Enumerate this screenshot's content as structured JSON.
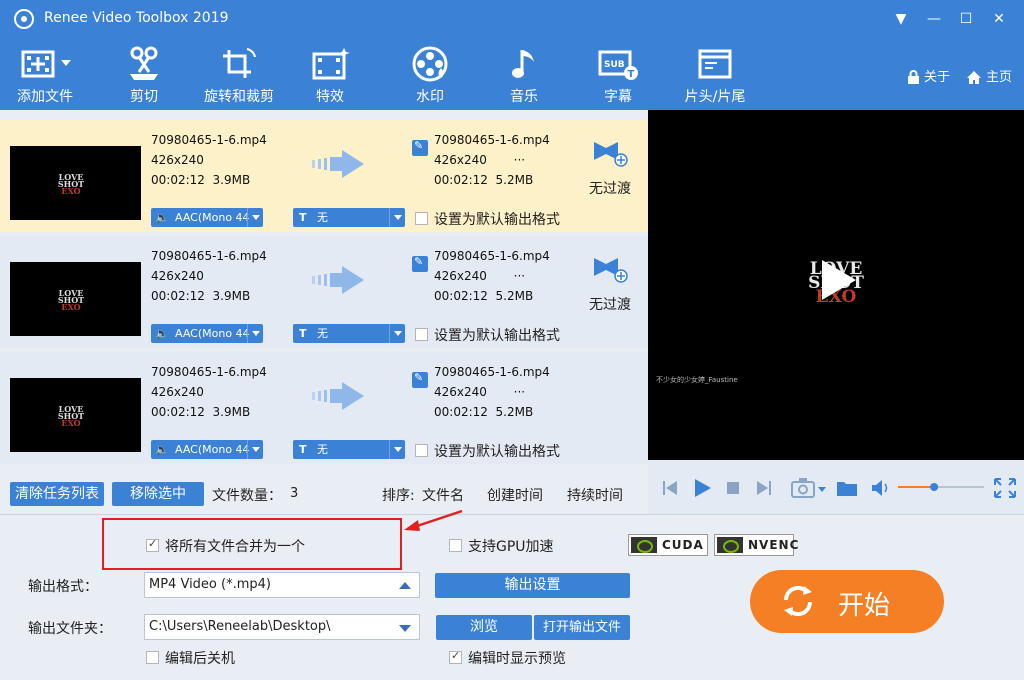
{
  "window": {
    "title": "Renee Video Toolbox 2019",
    "controls": [
      "▼",
      "—",
      "☐",
      "✕"
    ]
  },
  "toolbar": {
    "tools": [
      {
        "label": "添加文件",
        "icon": "add-file-icon"
      },
      {
        "label": "剪切",
        "icon": "scissors-icon"
      },
      {
        "label": "旋转和裁剪",
        "icon": "crop-rotate-icon"
      },
      {
        "label": "特效",
        "icon": "effects-icon"
      },
      {
        "label": "水印",
        "icon": "watermark-icon"
      },
      {
        "label": "音乐",
        "icon": "music-note-icon"
      },
      {
        "label": "字幕",
        "icon": "subtitle-icon"
      },
      {
        "label": "片头/片尾",
        "icon": "intro-outro-icon"
      }
    ],
    "about": "关于",
    "home": "主页"
  },
  "files": [
    {
      "name": "70980465-1-6.mp4",
      "resolution": "426x240",
      "duration": "00:02:12",
      "size": "3.9MB",
      "output_name": "70980465-1-6.mp4",
      "output_resolution": "426x240",
      "output_extra": "···",
      "output_duration": "00:02:12",
      "output_size": "5.2MB",
      "audio": "AAC(Mono 44",
      "subtitle_prefix": "T",
      "subtitle": "无",
      "default_label": "设置为默认输出格式",
      "transition": "无过渡",
      "selected": true
    },
    {
      "name": "70980465-1-6.mp4",
      "resolution": "426x240",
      "duration": "00:02:12",
      "size": "3.9MB",
      "output_name": "70980465-1-6.mp4",
      "output_resolution": "426x240",
      "output_extra": "···",
      "output_duration": "00:02:12",
      "output_size": "5.2MB",
      "audio": "AAC(Mono 44",
      "subtitle_prefix": "T",
      "subtitle": "无",
      "default_label": "设置为默认输出格式",
      "transition": "无过渡",
      "selected": false
    },
    {
      "name": "70980465-1-6.mp4",
      "resolution": "426x240",
      "duration": "00:02:12",
      "size": "3.9MB",
      "output_name": "70980465-1-6.mp4",
      "output_resolution": "426x240",
      "output_extra": "···",
      "output_duration": "00:02:12",
      "output_size": "5.2MB",
      "audio": "AAC(Mono 44",
      "subtitle_prefix": "T",
      "subtitle": "无",
      "default_label": "设置为默认输出格式",
      "transition": "",
      "selected": false
    }
  ],
  "thumb_logo": {
    "line1": "LOVE",
    "line2": "SHOT",
    "line3": "EXO",
    "caption": "不少女的少女婷_Faustine"
  },
  "list_footer": {
    "clear": "清除任务列表",
    "remove": "移除选中",
    "count_label": "文件数量：",
    "count": "3",
    "sort_label": "排序:",
    "sort_name": "文件名",
    "sort_created": "创建时间",
    "sort_duration": "持续时间"
  },
  "preview": {
    "logo1": "LOVE",
    "logo2": "SHOT",
    "logo3": "EXO",
    "caption": "不少女的少女婷_Faustine",
    "volume": 0.42
  },
  "bottom": {
    "merge_label": "将所有文件合并为一个",
    "merge_checked": true,
    "gpu_label": "支持GPU加速",
    "gpu_checked": false,
    "cuda": "CUDA",
    "nvenc": "NVENC",
    "format_label": "输出格式：",
    "format_value": "MP4 Video (*.mp4)",
    "output_settings": "输出设置",
    "folder_label": "输出文件夹：",
    "folder_value": "C:\\Users\\Reneelab\\Desktop\\",
    "browse": "浏览",
    "open_output": "打开输出文件",
    "shutdown_label": "编辑后关机",
    "shutdown_checked": false,
    "preview_label": "编辑时显示预览",
    "preview_checked": true,
    "start": "开始"
  },
  "colors": {
    "accent": "#3b82d6",
    "start": "#f47f24",
    "selected_row": "#fdf1c9",
    "highlight": "#e02020"
  }
}
